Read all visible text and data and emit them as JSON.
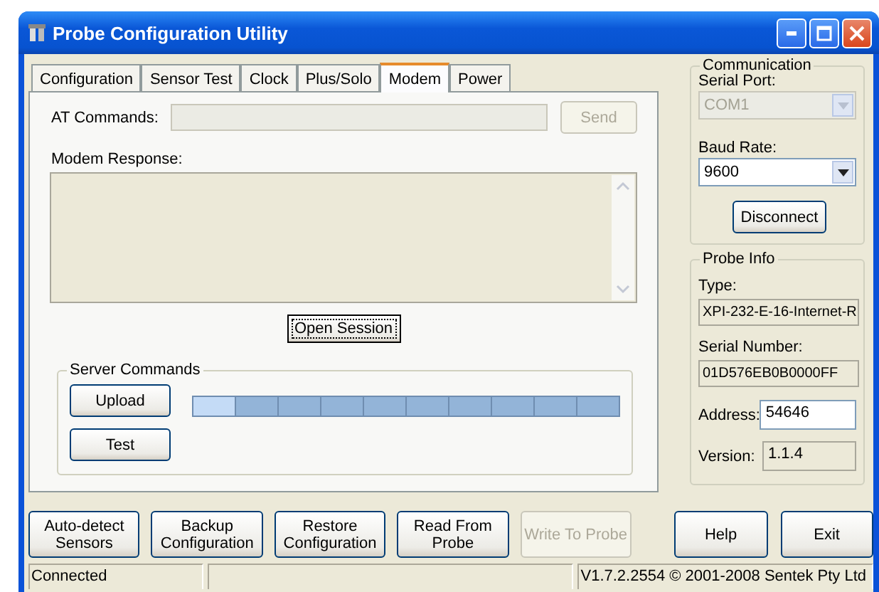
{
  "window": {
    "title": "Probe Configuration Utility"
  },
  "tabs": [
    {
      "label": "Configuration",
      "selected": false
    },
    {
      "label": "Sensor Test",
      "selected": false
    },
    {
      "label": "Clock",
      "selected": false
    },
    {
      "label": "Plus/Solo",
      "selected": false
    },
    {
      "label": "Modem",
      "selected": true
    },
    {
      "label": "Power",
      "selected": false
    }
  ],
  "modem": {
    "at_commands": {
      "label": "AT Commands:",
      "disabled": true
    },
    "send_button": {
      "label": "Send",
      "disabled": true
    },
    "modem_response": {
      "label": "Modem Response:"
    },
    "open_session_button": {
      "label": "Open Session",
      "focused": true
    },
    "server_commands": {
      "title": "Server Commands",
      "buttons": [
        {
          "label": "Upload"
        },
        {
          "label": "Test"
        }
      ],
      "progress": {
        "level": 0.1
      }
    }
  },
  "communication": {
    "title": "Communication",
    "serial_port": {
      "label": "Serial Port:",
      "value": "COM1",
      "disabled": true
    },
    "baud_rate": {
      "label": "Baud Rate:",
      "value": "9600",
      "disabled": false
    },
    "disconnect_button": {
      "label": "Disconnect"
    }
  },
  "probe_info": {
    "title": "Probe Info",
    "fields": [
      {
        "label": "Type:",
        "value": "XPI-232-E-16-Internet-R",
        "kind": "stacked",
        "editable": false
      },
      {
        "label": "Serial Number:",
        "value": "01D576EB0B0000FF",
        "kind": "stacked",
        "editable": false
      },
      {
        "label": "Address:",
        "value": "54646",
        "kind": "inline",
        "editable": true
      },
      {
        "label": "Version:",
        "value": "1.1.4",
        "kind": "inline",
        "editable": false
      }
    ]
  },
  "actions": [
    {
      "label": "Auto-detect\nSensors",
      "disabled": false
    },
    {
      "label": "Backup\nConfiguration",
      "disabled": false
    },
    {
      "label": "Restore\nConfiguration",
      "disabled": false
    },
    {
      "label": "Read From\nProbe",
      "disabled": false
    },
    {
      "label": "Write To Probe",
      "disabled": true
    }
  ],
  "side_buttons": [
    {
      "label": "Help"
    },
    {
      "label": "Exit"
    }
  ],
  "status_bar": {
    "status": "Connected",
    "version": "V1.7.2.2554 © 2001-2008 Sentek Pty Ltd"
  }
}
